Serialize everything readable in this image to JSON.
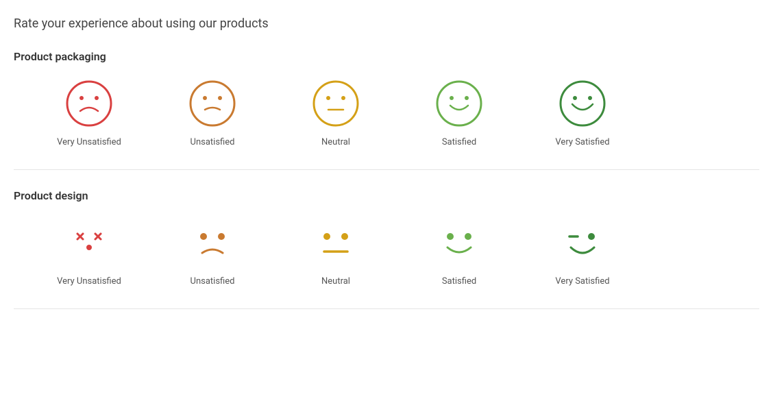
{
  "page": {
    "title": "Rate your experience about using our products",
    "sections": [
      {
        "id": "product-packaging",
        "label": "Product packaging",
        "type": "circle-faces",
        "items": [
          {
            "id": "very-unsatisfied",
            "label": "Very Unsatisfied",
            "color": "#d94040",
            "face": "very-unsatisfied-circle"
          },
          {
            "id": "unsatisfied",
            "label": "Unsatisfied",
            "color": "#c97a30",
            "face": "unsatisfied-circle"
          },
          {
            "id": "neutral",
            "label": "Neutral",
            "color": "#d4a017",
            "face": "neutral-circle"
          },
          {
            "id": "satisfied",
            "label": "Satisfied",
            "color": "#6ab04c",
            "face": "satisfied-circle"
          },
          {
            "id": "very-satisfied",
            "label": "Very Satisfied",
            "color": "#3d8b3d",
            "face": "very-satisfied-circle"
          }
        ]
      },
      {
        "id": "product-design",
        "label": "Product design",
        "type": "minimal-faces",
        "items": [
          {
            "id": "very-unsatisfied",
            "label": "Very Unsatisfied",
            "color": "#d94040",
            "face": "very-unsatisfied-minimal"
          },
          {
            "id": "unsatisfied",
            "label": "Unsatisfied",
            "color": "#c97a30",
            "face": "unsatisfied-minimal"
          },
          {
            "id": "neutral",
            "label": "Neutral",
            "color": "#d4a017",
            "face": "neutral-minimal"
          },
          {
            "id": "satisfied",
            "label": "Satisfied",
            "color": "#6ab04c",
            "face": "satisfied-minimal"
          },
          {
            "id": "very-satisfied",
            "label": "Very Satisfied",
            "color": "#3d8b3d",
            "face": "very-satisfied-minimal"
          }
        ]
      }
    ]
  }
}
